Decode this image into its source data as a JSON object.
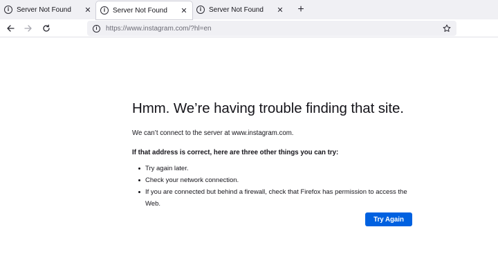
{
  "tabs": [
    {
      "title": "Server Not Found",
      "active": false,
      "icon": "info-circle-icon"
    },
    {
      "title": "Server Not Found",
      "active": true,
      "icon": "info-circle-icon"
    },
    {
      "title": "Server Not Found",
      "active": false,
      "icon": "info-circle-icon"
    }
  ],
  "tab_close_glyph": "✕",
  "new_tab_glyph": "+",
  "navbar": {
    "url": "https://www.instagram.com/?hl=en"
  },
  "error": {
    "title": "Hmm. We’re having trouble finding that site.",
    "description": "We can’t connect to the server at www.instagram.com.",
    "subhead": "If that address is correct, here are three other things you can try:",
    "suggestions": [
      "Try again later.",
      "Check your network connection.",
      "If you are connected but behind a firewall, check that Firefox has permission to access the Web."
    ],
    "button_label": "Try Again"
  },
  "colors": {
    "accent": "#0061e0",
    "tabstrip_bg": "#f0f0f4",
    "text": "#15141a"
  }
}
